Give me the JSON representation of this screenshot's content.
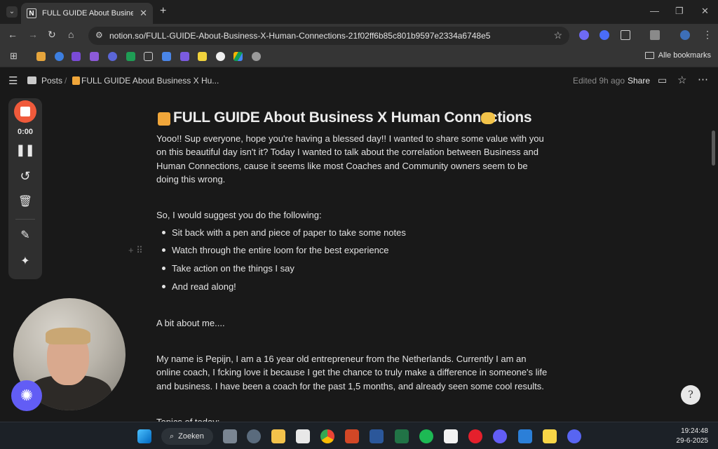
{
  "browser": {
    "tab_title": "FULL GUIDE About Business X H",
    "tab_icon": "N",
    "url": "notion.so/FULL-GUIDE-About-Business-X-Human-Connections-21f02ff6b85c801b9597e2334a6748e5",
    "all_bookmarks": "Alle bookmarks"
  },
  "notion": {
    "breadcrumb_root": "Posts",
    "breadcrumb_sep": "/",
    "breadcrumb_page": "FULL GUIDE About Business X Hu...",
    "edited": "Edited 9h ago",
    "share": "Share"
  },
  "page": {
    "title": "FULL GUIDE About Business X Human Connections",
    "intro": "Yooo!! Sup everyone, hope you're having a blessed day!! I wanted to share some value with you on this beautiful day isn't it? Today I wanted to talk about the correlation between Business and Human Connections, cause it seems like most Coaches and Community owners seem to be doing this wrong.",
    "suggest": "So, I would suggest you do the following:",
    "bullets": [
      "Sit back with a pen and piece of paper to take some notes",
      "Watch through the entire loom for the best experience",
      "Take action on the things I say",
      "And read along!"
    ],
    "about_heading": "A bit about me....",
    "about_text": "My name is Pepijn, I am a 16 year old entrepreneur from the Netherlands. Currently I am an online coach, I fcking love it because I get the chance to truly make a difference in someone's life and business. I have been a coach for the past 1,5 months, and already seen some cool results.",
    "topics": "Topics of today:"
  },
  "loom": {
    "timer": "0:00"
  },
  "taskbar": {
    "search": "Zoeken",
    "time": "19:24:48",
    "date": "29-6-2025"
  },
  "colors": {
    "accent_loom": "#625df5",
    "record_red": "#f05a3b"
  }
}
